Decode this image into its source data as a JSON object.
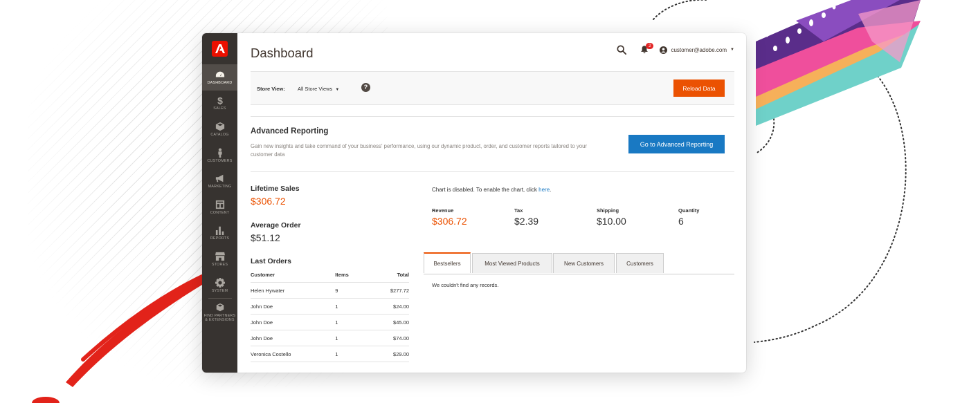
{
  "header": {
    "title": "Dashboard",
    "notification_count": "2",
    "account_email": "customer@adobe.com"
  },
  "sidebar": {
    "items": [
      {
        "label": "DASHBOARD",
        "icon": "dashboard-icon",
        "active": true
      },
      {
        "label": "SALES",
        "icon": "dollar-icon"
      },
      {
        "label": "CATALOG",
        "icon": "box-icon"
      },
      {
        "label": "CUSTOMERS",
        "icon": "person-icon"
      },
      {
        "label": "MARKETING",
        "icon": "megaphone-icon"
      },
      {
        "label": "CONTENT",
        "icon": "layout-icon"
      },
      {
        "label": "REPORTS",
        "icon": "bar-chart-icon"
      },
      {
        "label": "STORES",
        "icon": "storefront-icon"
      },
      {
        "label": "SYSTEM",
        "icon": "gear-icon"
      },
      {
        "label": "FIND PARTNERS & EXTENSIONS",
        "icon": "cubes-icon"
      }
    ]
  },
  "store_view": {
    "label": "Store View:",
    "value": "All Store Views",
    "reload_label": "Reload Data"
  },
  "advanced_reporting": {
    "title": "Advanced Reporting",
    "description": "Gain new insights and take command of your business' performance, using our dynamic product, order, and customer reports tailored to your customer data",
    "button_label": "Go to Advanced Reporting"
  },
  "stats": {
    "lifetime_sales_label": "Lifetime Sales",
    "lifetime_sales_value": "$306.72",
    "average_order_label": "Average Order",
    "average_order_value": "$51.12"
  },
  "last_orders": {
    "title": "Last Orders",
    "columns": [
      "Customer",
      "Items",
      "Total"
    ],
    "rows": [
      {
        "customer": "Helen Hywater",
        "items": "9",
        "total": "$277.72"
      },
      {
        "customer": "John Doe",
        "items": "1",
        "total": "$24.00"
      },
      {
        "customer": "John Doe",
        "items": "1",
        "total": "$45.00"
      },
      {
        "customer": "John Doe",
        "items": "1",
        "total": "$74.00"
      },
      {
        "customer": "Veronica Costello",
        "items": "1",
        "total": "$29.00"
      }
    ]
  },
  "chart": {
    "message": "Chart is disabled. To enable the chart, click ",
    "link_text": "here",
    "message_end": "."
  },
  "totals": [
    {
      "label": "Revenue",
      "value": "$306.72"
    },
    {
      "label": "Tax",
      "value": "$2.39"
    },
    {
      "label": "Shipping",
      "value": "$10.00"
    },
    {
      "label": "Quantity",
      "value": "6"
    }
  ],
  "tabs": {
    "items": [
      "Bestsellers",
      "Most Viewed Products",
      "New Customers",
      "Customers"
    ],
    "active": "Bestsellers",
    "empty_message": "We couldn't find any records."
  },
  "colors": {
    "accent": "#eb5202",
    "link": "#1979c3",
    "sidebar": "#373330",
    "brand": "#eb1000"
  }
}
